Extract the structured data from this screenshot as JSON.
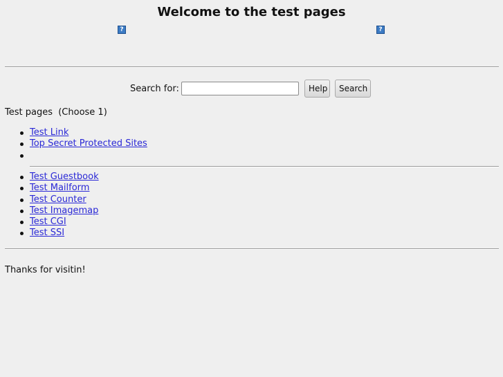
{
  "page": {
    "title": "Welcome to the test pages",
    "help_icon_glyph": "?"
  },
  "search": {
    "label": "Search for:",
    "value": "",
    "placeholder": "",
    "help_button_label": "Help",
    "search_button_label": "Search"
  },
  "section": {
    "title": "Test pages  (Choose 1)"
  },
  "links_top": [
    {
      "label": "Test Link"
    },
    {
      "label": "Top Secret Protected Sites"
    }
  ],
  "links_bottom": [
    {
      "label": "Test Guestbook"
    },
    {
      "label": "Test Mailform"
    },
    {
      "label": "Test Counter"
    },
    {
      "label": "Test Imagemap"
    },
    {
      "label": "Test CGI"
    },
    {
      "label": "Test SSI"
    }
  ],
  "footer": {
    "text": "Thanks for visitin!"
  },
  "colors": {
    "background": "#efefef",
    "link": "#2a28d6",
    "icon": "#3c7bc4"
  }
}
